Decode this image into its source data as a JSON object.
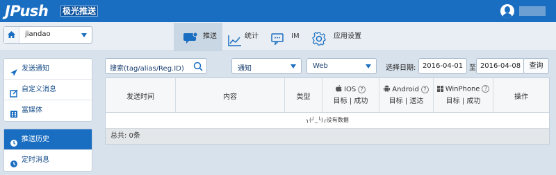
{
  "header": {
    "logo_text": "JPush",
    "logo_cn": "极光推送"
  },
  "app_selector": {
    "value": "jiandao"
  },
  "nav": {
    "tabs": [
      {
        "label": "推送"
      },
      {
        "label": "统计"
      },
      {
        "label": "IM"
      },
      {
        "label": "应用设置"
      }
    ]
  },
  "sidebar": {
    "group1": [
      {
        "label": "发送通知"
      },
      {
        "label": "自定义消息"
      },
      {
        "label": "富媒体"
      }
    ],
    "group2": [
      {
        "label": "推送历史"
      },
      {
        "label": "定时消息"
      }
    ]
  },
  "filters": {
    "search_placeholder": "搜索(tag/alias/Reg.ID)",
    "type_value": "通知",
    "platform_value": "Web",
    "date_label": "选择日期:",
    "date_from": "2016-04-01",
    "date_sep": "至",
    "date_to": "2016-04-08",
    "query_label": "查询"
  },
  "table": {
    "headers": {
      "send_time": "发送时间",
      "content": "内容",
      "type": "类型",
      "ios": "IOS",
      "ios_sub": "目标 | 成功",
      "android": "Android",
      "android_sub": "目标 | 送达",
      "winphone": "WinPhone",
      "winphone_sub": "目标 | 成功",
      "action": "操作"
    },
    "empty_text": "╮(╯_╰)╭没有数据",
    "total_text": "总共: 0条"
  },
  "colors": {
    "brand": "#1a6ec1",
    "active_tab": "#c9d6e3",
    "background": "#d8e2ec"
  }
}
